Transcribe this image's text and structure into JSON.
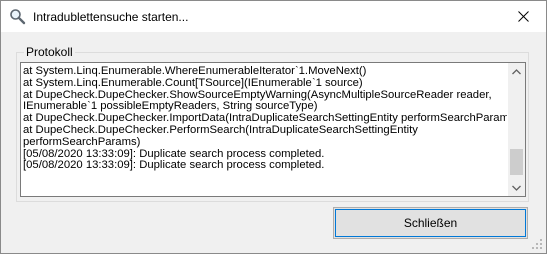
{
  "window": {
    "title": "Intradublettensuche starten...",
    "close_symbol": "✕"
  },
  "icons": {
    "title": "magnifier-icon",
    "close": "close-icon",
    "scroll_up": "chevron-up-icon",
    "scroll_down": "chevron-down-icon",
    "grip": "resize-grip-icon"
  },
  "group": {
    "label": "Protokoll"
  },
  "log": {
    "lines": [
      "   at System.Linq.Enumerable.WhereEnumerableIterator`1.MoveNext()",
      "   at System.Linq.Enumerable.Count[TSource](IEnumerable`1 source)",
      "   at DupeCheck.DupeChecker.ShowSourceEmptyWarning(AsyncMultipleSourceReader reader,",
      "IEnumerable`1 possibleEmptyReaders, String sourceType)",
      "   at DupeCheck.DupeChecker.ImportData(IntraDuplicateSearchSettingEntity performSearchParams)",
      "   at DupeCheck.DupeChecker.PerformSearch(IntraDuplicateSearchSettingEntity",
      "performSearchParams)",
      "[05/08/2020 13:33:09]: Duplicate search process completed.",
      "[05/08/2020 13:33:09]: Duplicate search process completed."
    ]
  },
  "buttons": {
    "close_label": "Schließen"
  },
  "colors": {
    "accent_focus": "#0078d7",
    "button_face": "#e1e1e1",
    "dialog_bg": "#f0f0f0"
  }
}
